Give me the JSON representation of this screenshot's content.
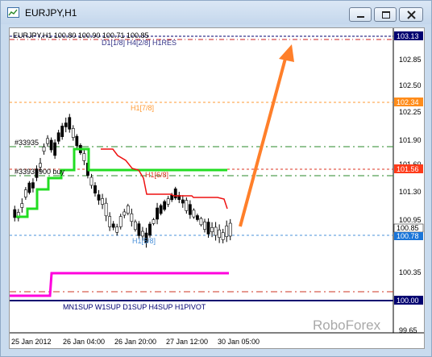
{
  "window": {
    "title": "EURJPY,H1"
  },
  "header": {
    "quote_line": "EURJPY,H1  100.80 100.90 100.71 100.85"
  },
  "watermark": "RoboForex",
  "price_axis": {
    "ticks": [
      "102.85",
      "102.50",
      "102.25",
      "101.90",
      "101.60",
      "101.30",
      "100.95",
      "100.35",
      "99.65"
    ],
    "price_tags": {
      "top_level": "103.13",
      "h1_7_8": "102.34",
      "red_level": "101.56",
      "current_price": "100.85",
      "h1_5_8": "100.78",
      "bottom_pivot": "100.00"
    }
  },
  "time_axis": {
    "ticks": [
      "25 Jan 2012",
      "26 Jan 04:00",
      "26 Jan 20:00",
      "27 Jan 12:00",
      "30 Jan 05:00"
    ]
  },
  "annotations": {
    "top_label": "D1[1/8] H4[2/8] H1RES",
    "h1_7_8": "H1[7/8]",
    "hash_label_1": "#33935",
    "hash_label_2": "#33935900 buy",
    "h1_6_8": "H1[6/8]",
    "h1_5_8": "H1[5/8]",
    "bottom_label": "MN1SUP W1SUP D1SUP H4SUP H1PIVOT"
  },
  "colors": {
    "green_line": "#22dd22",
    "red_line": "#ee1111",
    "magenta_line": "#ff00dd",
    "arrow": "#ff7f2a",
    "navy": "#000070",
    "orange_tag": "#ff8c1a",
    "red_tag": "#ff3b1a",
    "blue_tag": "#1a75d8"
  },
  "chart_data": {
    "type": "candlestick",
    "instrument": "EURJPY",
    "timeframe": "H1",
    "ohlc_current": [
      100.8,
      100.9,
      100.71,
      100.85
    ],
    "horizontal_levels": [
      103.13,
      102.34,
      101.78,
      101.56,
      101.48,
      100.78,
      100.1,
      100.0
    ]
  }
}
